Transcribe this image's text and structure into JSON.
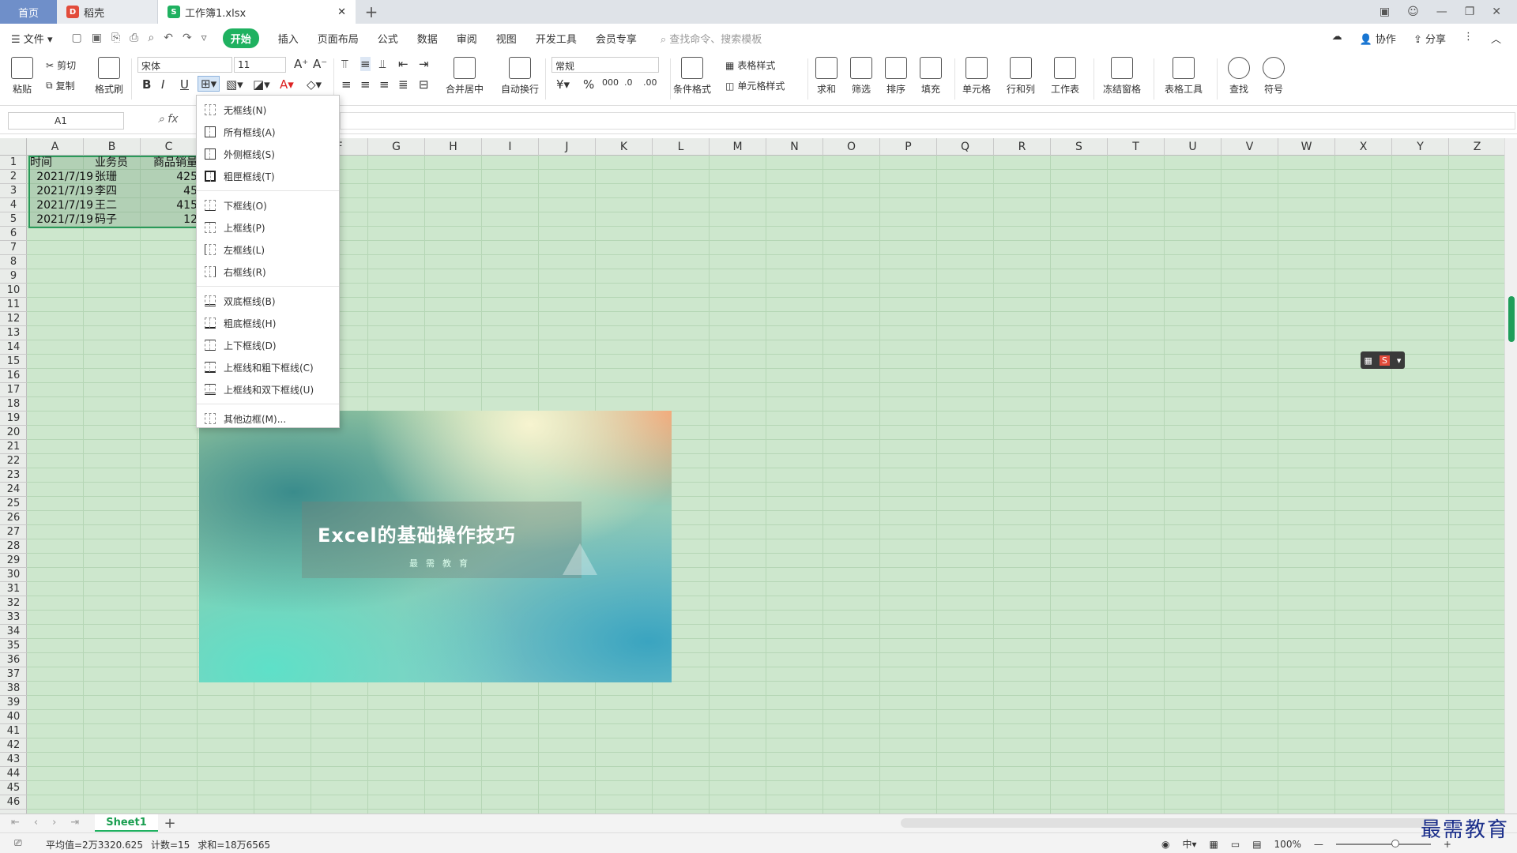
{
  "tabs": {
    "home": "首页",
    "daoke": "稻壳",
    "file": "工作簿1.xlsx",
    "add": "+"
  },
  "menubar": {
    "file": "文件",
    "active": "开始",
    "items": [
      "插入",
      "页面布局",
      "公式",
      "数据",
      "审阅",
      "视图",
      "开发工具",
      "会员专享"
    ],
    "search": "查找命令、搜索模板",
    "collab": "协作",
    "share": "分享"
  },
  "ribbon": {
    "paste": "粘贴",
    "cut": "剪切",
    "copy": "复制",
    "format_painter": "格式刷",
    "font": "宋体",
    "font_size": "11",
    "merge": "合并居中",
    "wrap": "自动换行",
    "number_format": "常规",
    "conditional": "条件格式",
    "table_style": "表格样式",
    "cell_style": "单元格样式",
    "sum": "求和",
    "filter": "筛选",
    "sort": "排序",
    "fill": "填充",
    "cell": "单元格",
    "row_col": "行和列",
    "worksheet": "工作表",
    "freeze": "冻结窗格",
    "table_tools": "表格工具",
    "find": "查找",
    "symbol": "符号"
  },
  "formula": {
    "name_box": "A1",
    "fx": "fx"
  },
  "columns": [
    "A",
    "B",
    "C",
    "D",
    "E",
    "F",
    "G",
    "H",
    "I",
    "J",
    "K",
    "L",
    "M",
    "N",
    "O",
    "P",
    "Q",
    "R",
    "S",
    "T",
    "U",
    "V",
    "W",
    "X",
    "Y",
    "Z"
  ],
  "rows": [
    "1",
    "2",
    "3",
    "4",
    "5",
    "6",
    "7",
    "8",
    "9",
    "10",
    "11",
    "12",
    "13",
    "14",
    "15",
    "16",
    "17",
    "18",
    "19",
    "20",
    "21",
    "22",
    "23",
    "24",
    "25",
    "26",
    "27",
    "28",
    "29",
    "30",
    "31",
    "32",
    "33",
    "34",
    "35",
    "36",
    "37",
    "38",
    "39",
    "40",
    "41",
    "42",
    "43",
    "44",
    "45",
    "46"
  ],
  "table": {
    "headers": [
      "时间",
      "业务员",
      "商品销量"
    ],
    "rows": [
      [
        "2021/7/19",
        "张珊",
        "425"
      ],
      [
        "2021/7/19",
        "李四",
        "45"
      ],
      [
        "2021/7/19",
        "王二",
        "415"
      ],
      [
        "2021/7/19",
        "码子",
        "12"
      ]
    ]
  },
  "banner": {
    "title": "Excel的基础操作技巧",
    "subtitle": "最需教育"
  },
  "border_menu": {
    "items": [
      "无框线(N)",
      "所有框线(A)",
      "外侧框线(S)",
      "粗匣框线(T)",
      "下框线(O)",
      "上框线(P)",
      "左框线(L)",
      "右框线(R)",
      "双底框线(B)",
      "粗底框线(H)",
      "上下框线(D)",
      "上框线和粗下框线(C)",
      "上框线和双下框线(U)",
      "其他边框(M)..."
    ]
  },
  "sheet": {
    "tab": "Sheet1"
  },
  "status": {
    "average": "平均值=2万3320.625",
    "count": "计数=15",
    "sum": "求和=18万6565",
    "zoom": "100%"
  },
  "watermark": "最需教育",
  "colors": {
    "accent": "#1fb160",
    "grid_bg": "#cde7cd"
  }
}
